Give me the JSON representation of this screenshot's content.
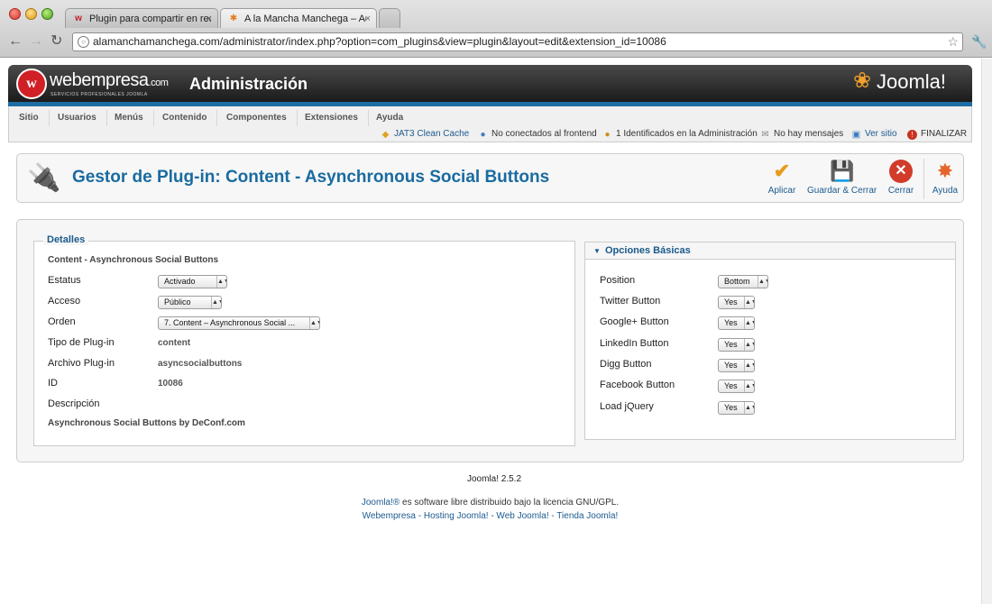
{
  "browser": {
    "tabs": [
      {
        "title": "Plugin para compartir en red",
        "favicon": "w",
        "close": "×"
      },
      {
        "title": "A la Mancha Manchega – Ad",
        "favicon": "✱",
        "close": "×"
      }
    ],
    "url": "alamanchamanchega.com/administrator/index.php?option=com_plugins&view=plugin&layout=edit&extension_id=10086"
  },
  "header": {
    "brand": "webempresa",
    "brand_suffix": ".com",
    "brand_sub": "SERVICIOS PROFESIONALES JOOMLA",
    "title": "Administración",
    "joomla_logo": "Joomla!"
  },
  "menu": [
    "Sitio",
    "Usuarios",
    "Menús",
    "Contenido",
    "Componentes",
    "Extensiones",
    "Ayuda"
  ],
  "status": {
    "cache": "JAT3 Clean Cache",
    "frontend": "No conectados al frontend",
    "admins": "1 Identificados en la Administración",
    "messages": "No hay mensajes",
    "view_site": "Ver sitio",
    "logout": "FINALIZAR"
  },
  "toolbar": {
    "title": "Gestor de Plug-in: Content - Asynchronous Social Buttons",
    "apply": "Aplicar",
    "save_close": "Guardar & Cerrar",
    "close": "Cerrar",
    "help": "Ayuda"
  },
  "details": {
    "legend": "Detalles",
    "plugin_name": "Content - Asynchronous Social Buttons",
    "status_label": "Estatus",
    "status_value": "Activado",
    "access_label": "Acceso",
    "access_value": "Público",
    "order_label": "Orden",
    "order_value": "7. Content – Asynchronous Social ...",
    "type_label": "Tipo de Plug-in",
    "type_value": "content",
    "file_label": "Archivo Plug-in",
    "file_value": "asyncsocialbuttons",
    "id_label": "ID",
    "id_value": "10086",
    "description_label": "Descripción",
    "description_value": "Asynchronous Social Buttons by DeConf.com"
  },
  "options": {
    "title": "Opciones Básicas",
    "items": [
      {
        "label": "Position",
        "value": "Bottom"
      },
      {
        "label": "Twitter Button",
        "value": "Yes"
      },
      {
        "label": "Google+ Button",
        "value": "Yes"
      },
      {
        "label": "LinkedIn Button",
        "value": "Yes"
      },
      {
        "label": "Digg Button",
        "value": "Yes"
      },
      {
        "label": "Facebook Button",
        "value": "Yes"
      },
      {
        "label": "Load jQuery",
        "value": "Yes"
      }
    ]
  },
  "footer": {
    "version": "Joomla! 2.5.2",
    "license_link": "Joomla!®",
    "license_text": " es software libre distribuido bajo la licencia GNU/GPL.",
    "links": "Webempresa - Hosting Joomla! - Web Joomla! - Tienda Joomla!"
  }
}
